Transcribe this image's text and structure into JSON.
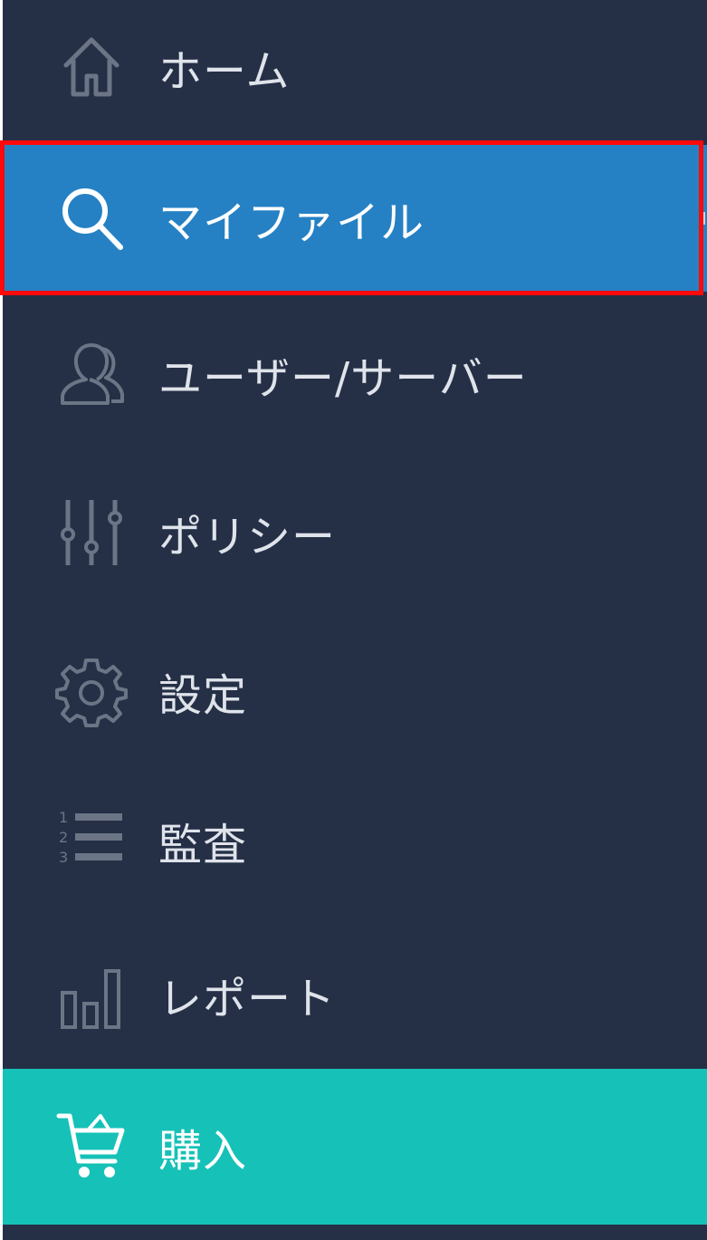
{
  "sidebar": {
    "items": [
      {
        "id": "home",
        "label": "ホーム",
        "icon": "home-icon"
      },
      {
        "id": "my-files",
        "label": "マイファイル",
        "icon": "search-icon",
        "active": true
      },
      {
        "id": "users-servers",
        "label": "ユーザー/サーバー",
        "icon": "user-icon"
      },
      {
        "id": "policy",
        "label": "ポリシー",
        "icon": "sliders-icon"
      },
      {
        "id": "settings",
        "label": "設定",
        "icon": "gear-icon"
      },
      {
        "id": "audit",
        "label": "監査",
        "icon": "numbered-list-icon"
      },
      {
        "id": "reports",
        "label": "レポート",
        "icon": "bar-chart-icon"
      },
      {
        "id": "purchase",
        "label": "購入",
        "icon": "cart-icon"
      }
    ]
  },
  "colors": {
    "sidebar_bg": "#253047",
    "active_bg": "#2581c4",
    "purchase_bg": "#16c1b7",
    "icon_gray": "#6b7585",
    "label_text": "#dfe3ea",
    "highlight_border": "#ff0a0a"
  }
}
